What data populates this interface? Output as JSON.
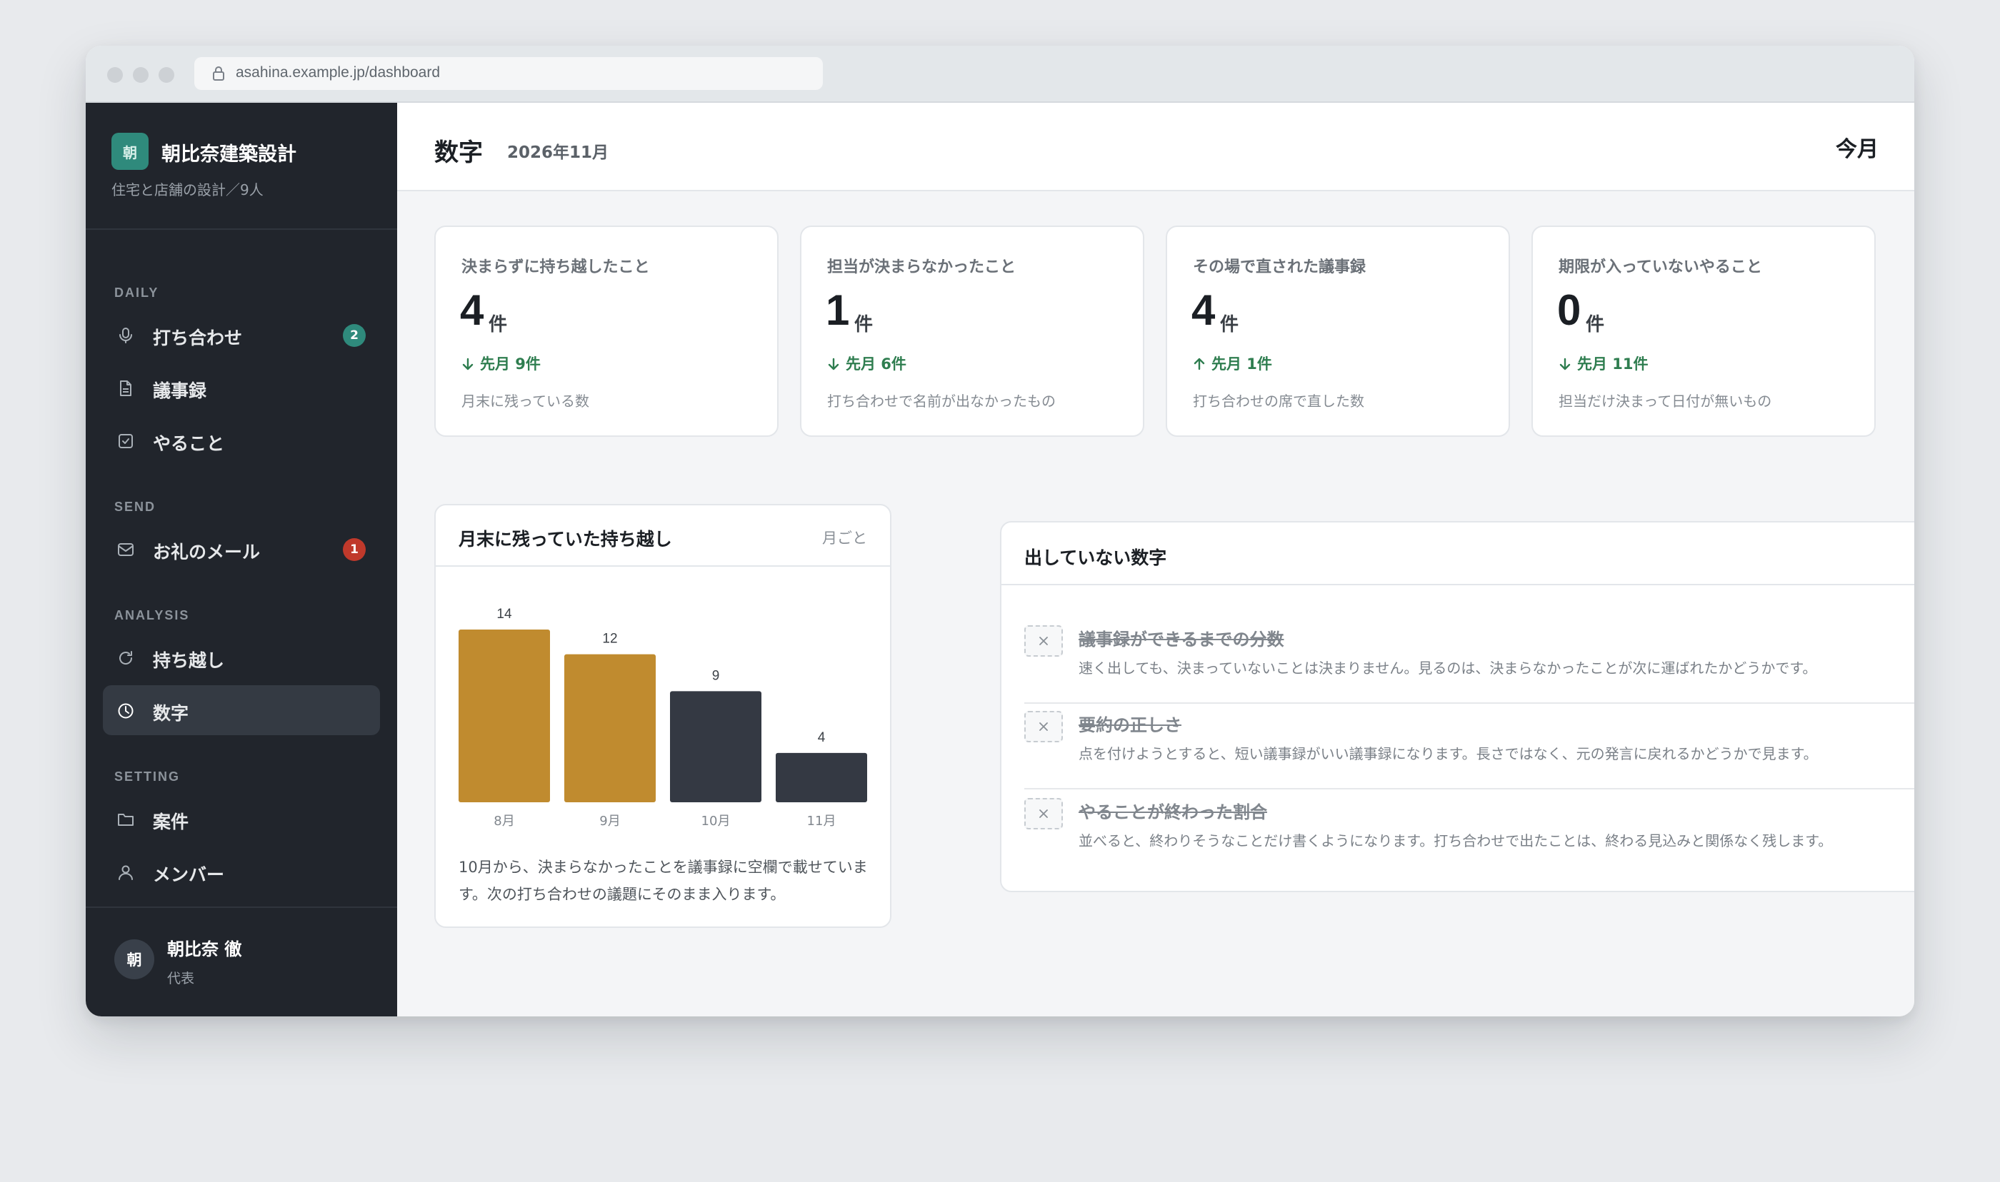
{
  "browser": {
    "url": "asahina.example.jp/dashboard"
  },
  "brand": {
    "mark": "朝",
    "name": "朝比奈建築設計",
    "subtitle": "住宅と店舗の設計／9人"
  },
  "sidebar": {
    "sections": [
      "DAILY",
      "SEND",
      "ANALYSIS",
      "SETTING"
    ],
    "items": [
      {
        "label": "打ち合わせ",
        "icon": "mic-icon",
        "badge": "2"
      },
      {
        "label": "議事録",
        "icon": "document-icon"
      },
      {
        "label": "やること",
        "icon": "checkbox-icon"
      },
      {
        "label": "お礼のメール",
        "icon": "mail-icon",
        "badge": "1"
      },
      {
        "label": "持ち越し",
        "icon": "refresh-icon"
      },
      {
        "label": "数字",
        "icon": "clock-icon",
        "active": true
      },
      {
        "label": "案件",
        "icon": "folder-icon"
      },
      {
        "label": "メンバー",
        "icon": "person-icon"
      }
    ]
  },
  "user": {
    "avatar": "朝",
    "name": "朝比奈 徹",
    "role": "代表"
  },
  "header": {
    "title": "数字",
    "period": "2026年11月",
    "range_button": "今月"
  },
  "kpis": [
    {
      "title": "決まらずに持ち越したこと",
      "value": "4",
      "unit": "件",
      "delta": "先月 9件",
      "direction": "down",
      "note": "月末に残っている数"
    },
    {
      "title": "担当が決まらなかったこと",
      "value": "1",
      "unit": "件",
      "delta": "先月 6件",
      "direction": "down",
      "note": "打ち合わせで名前が出なかったもの"
    },
    {
      "title": "その場で直された議事録",
      "value": "4",
      "unit": "件",
      "delta": "先月 1件",
      "direction": "up",
      "note": "打ち合わせの席で直した数"
    },
    {
      "title": "期限が入っていないやること",
      "value": "0",
      "unit": "件",
      "delta": "先月 11件",
      "direction": "down",
      "note": "担当だけ決まって日付が無いもの"
    }
  ],
  "chart_card": {
    "title": "月末に残っていた持ち越し",
    "period": "月ごと",
    "caption": "10月から、決まらなかったことを議事録に空欄で載せています。次の打ち合わせの議題にそのまま入ります。"
  },
  "chart_data": {
    "type": "bar",
    "categories": [
      "8月",
      "9月",
      "10月",
      "11月"
    ],
    "values": [
      14,
      12,
      9,
      4
    ],
    "colors": [
      "#c08b2f",
      "#c08b2f",
      "#343943",
      "#343943"
    ],
    "title": "月末に残っていた持ち越し",
    "xlabel": "",
    "ylabel": "",
    "ylim": [
      0,
      14
    ],
    "grid": false
  },
  "hidden_metrics": {
    "title": "出していない数字",
    "items": [
      {
        "name": "議事録ができるまでの分数",
        "desc": "速く出しても、決まっていないことは決まりません。見るのは、決まらなかったことが次に運ばれたかどうかです。"
      },
      {
        "name": "要約の正しさ",
        "desc": "点を付けようとすると、短い議事録がいい議事録になります。長さではなく、元の発言に戻れるかどうかで見ます。"
      },
      {
        "name": "やることが終わった割合",
        "desc": "並べると、終わりそうなことだけ書くようになります。打ち合わせで出たことは、終わる見込みと関係なく残します。"
      }
    ]
  },
  "colors": {
    "accent_teal": "#2f8a7c",
    "badge_red": "#c0392b",
    "positive_green": "#2e7d4f",
    "bar_gold": "#c08b2f",
    "bar_dark": "#343943",
    "sidebar_bg": "#21252c"
  }
}
